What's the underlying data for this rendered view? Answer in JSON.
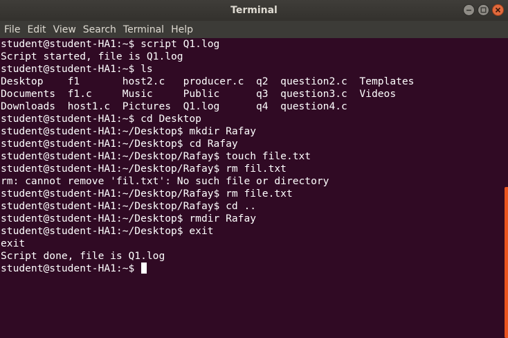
{
  "window": {
    "title": "Terminal"
  },
  "menubar": {
    "items": [
      "File",
      "Edit",
      "View",
      "Search",
      "Terminal",
      "Help"
    ]
  },
  "terminal": {
    "lines": [
      "student@student-HA1:~$ script Q1.log",
      "Script started, file is Q1.log",
      "student@student-HA1:~$ ls",
      "Desktop    f1       host2.c   producer.c  q2  question2.c  Templates",
      "Documents  f1.c     Music     Public      q3  question3.c  Videos",
      "Downloads  host1.c  Pictures  Q1.log      q4  question4.c",
      "student@student-HA1:~$ cd Desktop",
      "student@student-HA1:~/Desktop$ mkdir Rafay",
      "student@student-HA1:~/Desktop$ cd Rafay",
      "student@student-HA1:~/Desktop/Rafay$ touch file.txt",
      "student@student-HA1:~/Desktop/Rafay$ rm fil.txt",
      "rm: cannot remove 'fil.txt': No such file or directory",
      "student@student-HA1:~/Desktop/Rafay$ rm file.txt",
      "student@student-HA1:~/Desktop/Rafay$ cd ..",
      "student@student-HA1:~/Desktop$ rmdir Rafay",
      "student@student-HA1:~/Desktop$ exit",
      "exit",
      "Script done, file is Q1.log"
    ],
    "prompt": "student@student-HA1:~$ "
  },
  "colors": {
    "background": "#300a24",
    "text": "#ffffff",
    "scrollbar": "#e95420",
    "close_button": "#e26a3d"
  },
  "icons": [
    "minimize-icon",
    "maximize-icon",
    "close-icon"
  ]
}
